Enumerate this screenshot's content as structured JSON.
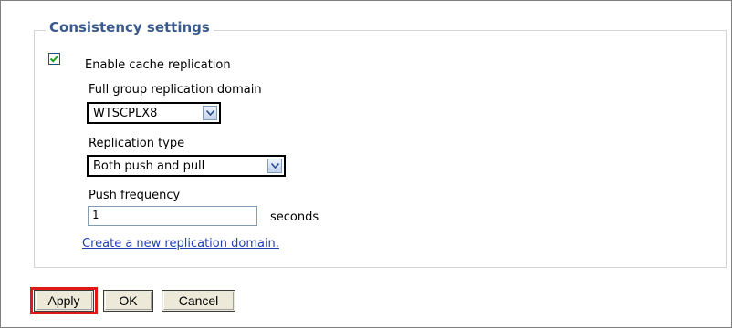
{
  "section": {
    "title": "Consistency settings"
  },
  "enable_replication": {
    "label": "Enable cache replication",
    "checked": true
  },
  "replication_domain": {
    "label": "Full group replication domain",
    "value": "WTSCPLX8"
  },
  "replication_type": {
    "label": "Replication type",
    "value": "Both push and pull"
  },
  "push_frequency": {
    "label": "Push frequency",
    "value": "1",
    "unit": "seconds"
  },
  "create_link": "Create a new replication domain.",
  "buttons": {
    "apply": "Apply",
    "ok": "OK",
    "cancel": "Cancel"
  },
  "colors": {
    "legend": "#3a5a8c",
    "link": "#2140b8",
    "highlight": "#e01818"
  }
}
